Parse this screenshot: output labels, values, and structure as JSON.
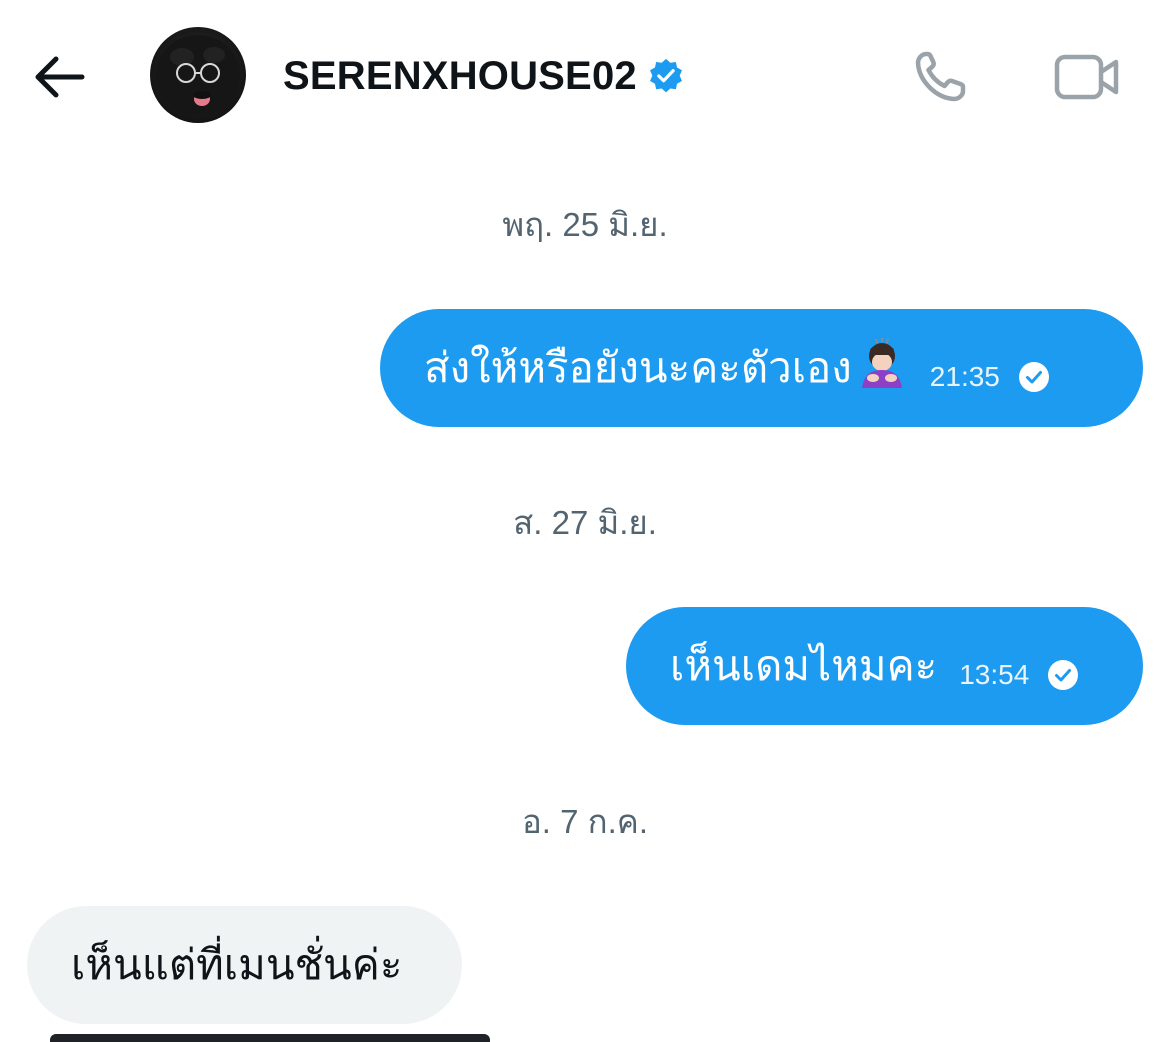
{
  "header": {
    "contact_name": "SERENXHOUSE02",
    "verified_icon": "verified-badge-icon",
    "back_icon": "arrow-left-icon",
    "call_icon": "phone-icon",
    "video_icon": "video-camera-icon",
    "icon_color": "#9aa3a9",
    "verified_color": "#1d9bf0"
  },
  "conversation": {
    "groups": [
      {
        "date": "พฤ. 25 มิ.ย.",
        "messages": [
          {
            "direction": "outgoing",
            "text": "ส่งให้หรือยังนะคะตัวเอง",
            "emoji": "person-bowing-emoji",
            "time": "21:35",
            "status": "read"
          }
        ]
      },
      {
        "date": "ส. 27 มิ.ย.",
        "messages": [
          {
            "direction": "outgoing",
            "text": "เห็นเดมไหมคะ",
            "time": "13:54",
            "status": "read"
          }
        ]
      },
      {
        "date": "อ. 7 ก.ค.",
        "messages": [
          {
            "direction": "incoming",
            "text": "เห็นแต่ที่เมนชั่นค่ะ"
          }
        ]
      }
    ]
  },
  "colors": {
    "outgoing_bubble": "#1d9bf0",
    "incoming_bubble": "#eff3f4",
    "date_text": "#536471",
    "primary_text": "#0f1419"
  }
}
